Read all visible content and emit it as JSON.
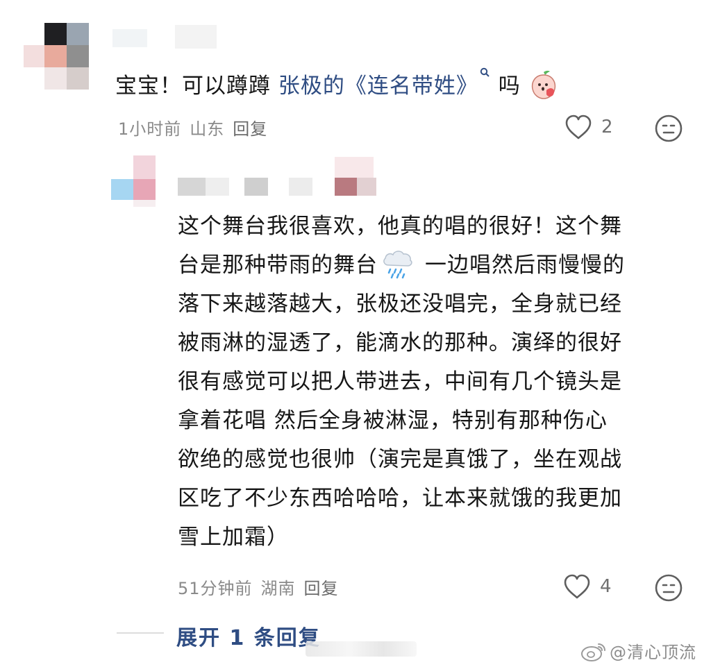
{
  "comment1": {
    "text_pre": "宝宝！可以蹲蹲 ",
    "link_text": "张极的《连名带姓》",
    "text_post": " 吗",
    "time": "1小时前",
    "location": "山东",
    "reply_label": "回复",
    "like_count": "2"
  },
  "reply1": {
    "lines": [
      "这个舞台我很喜欢，他真的唱的很好！这个舞",
      "台是那种带雨的舞台",
      "一边唱然后雨慢慢的",
      "落下来越落越大，张极还没唱完，全身就已经",
      "被雨淋的湿透了，能滴水的那种。演绎的很好",
      "很有感觉可以把人带进去，中间有几个镜头是",
      "拿着花唱 然后全身被淋湿，特别有那种伤心",
      "欲绝的感觉也很帅（演完是真饿了，坐在观战",
      "区吃了不少东西哈哈哈，让本来就饿的我更加",
      "雪上加霜）"
    ],
    "time": "51分钟前",
    "location": "湖南",
    "reply_label": "回复",
    "like_count": "4"
  },
  "expand_label": "展开 1 条回复",
  "watermark": "@清心顶流",
  "icons": {
    "heart": "heart-outline-icon",
    "emoji": "neutral-face-icon",
    "rain": "rain-cloud-emoji",
    "peach": "peach-face-emoji",
    "search": "search-icon",
    "weibo": "weibo-logo-icon"
  },
  "colors": {
    "link": "#2f4d83",
    "meta": "#8a8a8a",
    "text": "#161616"
  }
}
